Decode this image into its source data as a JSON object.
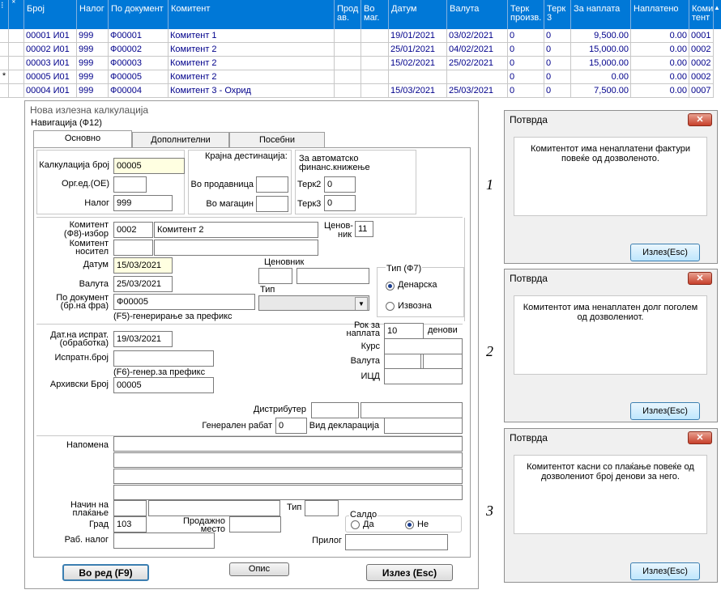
{
  "grid": {
    "headers": [
      "Број",
      "Налог",
      "По документ",
      "Комитент",
      "Прод ав.",
      "Во маг.",
      "Датум",
      "Валута",
      "Терк произв.",
      "Терк 3",
      "За наплата",
      "Наплатено",
      "Коми тент"
    ],
    "rows": [
      {
        "indicator": "",
        "broj": "00001  И01",
        "nalog": "999",
        "dokument": "Ф00001",
        "komitent": "Комитент 1",
        "datum": "19/01/2021",
        "valuta": "03/02/2021",
        "terk1": "0",
        "terk3": "0",
        "za_naplata": "9,500.00",
        "naplateno": "0.00",
        "komitent_kod": "0001"
      },
      {
        "indicator": "",
        "broj": "00002  И01",
        "nalog": "999",
        "dokument": "Ф00002",
        "komitent": "Комитент 2",
        "datum": "25/01/2021",
        "valuta": "04/02/2021",
        "terk1": "0",
        "terk3": "0",
        "za_naplata": "15,000.00",
        "naplateno": "0.00",
        "komitent_kod": "0002"
      },
      {
        "indicator": "",
        "broj": "00003  И01",
        "nalog": "999",
        "dokument": "Ф00003",
        "komitent": "Комитент 2",
        "datum": "15/02/2021",
        "valuta": "25/02/2021",
        "terk1": "0",
        "terk3": "0",
        "za_naplata": "15,000.00",
        "naplateno": "0.00",
        "komitent_kod": "0002"
      },
      {
        "indicator": "*",
        "broj": "00005  И01",
        "nalog": "999",
        "dokument": "Ф00005",
        "komitent": "Комитент 2",
        "datum": "",
        "valuta": "",
        "terk1": "0",
        "terk3": "0",
        "za_naplata": "0.00",
        "naplateno": "0.00",
        "komitent_kod": "0002"
      },
      {
        "indicator": "",
        "broj": "00004  И01",
        "nalog": "999",
        "dokument": "Ф00004",
        "komitent": "Комитент 3 - Охрид",
        "datum": "15/03/2021",
        "valuta": "25/03/2021",
        "terk1": "0",
        "terk3": "0",
        "za_naplata": "7,500.00",
        "naplateno": "0.00",
        "komitent_kod": "0007"
      }
    ]
  },
  "form": {
    "title": "Нова излезна калкулација",
    "nav_label": "Навигација (Ф12)",
    "tabs": [
      "Основно",
      "Дополнителни",
      "Посебни"
    ],
    "kalk_broj_label": "Калкулација број",
    "kalk_broj": "00005",
    "org_ed_label": "Орг.ед.(ОЕ)",
    "nalog_label": "Налог",
    "nalog": "999",
    "krajna_label": "Крајна дестинација:",
    "vo_prodavnica_label": "Во продавница",
    "vo_magacin_label": "Во магацин",
    "avtomatsko_label1": "За автоматско",
    "avtomatsko_label2": "финанс.книжење",
    "terk2_label": "Терк2",
    "terk2": "0",
    "terk3_label": "Терк3",
    "terk3": "0",
    "komitent_label1": "Комитент",
    "komitent_label2": "(Ф8)-избор",
    "komitent_kod": "0002",
    "komitent_ime": "Комитент 2",
    "cenovnik_short1": "Ценов-",
    "cenovnik_short2": "ник",
    "cenovnik_short_val": "11",
    "nositel_label1": "Комитент",
    "nositel_label2": "носител",
    "datum_label": "Датум",
    "datum": "15/03/2021",
    "cenovnik_label": "Ценовник",
    "valuta_label": "Валута",
    "valuta": "25/03/2021",
    "tip_label": "Тип",
    "po_dokument_label1": "По документ",
    "po_dokument_label2": "(бр.на фра)",
    "po_dokument": "Ф00005",
    "generiranje_label": "(F5)-генерирање за префикс",
    "tip_f7_label": "Тип (Ф7)",
    "radio_denarska": "Денарска",
    "radio_izvozna": "Извозна",
    "dat_isprat_label1": "Дат.на испрат.",
    "dat_isprat_label2": "(обработка)",
    "dat_isprat": "19/03/2021",
    "rok_label1": "Рок за",
    "rok_label2": "наплата",
    "rok": "10",
    "denovi_label": "денови",
    "ispratn_label": "Испратн.број",
    "kurs_label": "Курс",
    "generiranje2_label": "(F6)-генер.за префикс",
    "valuta2_label": "Валута",
    "arhivski_label": "Архивски Број",
    "arhivski": "00005",
    "icd_label": "ИЦД",
    "distributer_label": "Дистрибутер",
    "rabat_label": "Генерален рабат",
    "rabat": "0",
    "deklaracija_label": "Вид декларација",
    "napomena_label": "Напомена",
    "nacin_label1": "Начин на",
    "nacin_label2": "плаќање",
    "tip2_label": "Тип",
    "grad_label": "Град",
    "grad": "103",
    "prodazno_label1": "Продажно",
    "prodazno_label2": "место",
    "saldo_label": "Салдо",
    "saldo_da": "Да",
    "saldo_ne": "Не",
    "rab_nalog_label": "Раб. налог",
    "prilog_label": "Прилог",
    "btn_vo_red": "Во ред (F9)",
    "btn_opis": "Опис",
    "btn_izlez": "Излез (Esc)"
  },
  "dialogs": [
    {
      "title": "Потврда",
      "message": "Комитентот има ненаплатени фактури повеќе од дозволеното.",
      "button": "Излез(Esc)",
      "number": "1"
    },
    {
      "title": "Потврда",
      "message": "Комитентот има ненаплатен долг поголем од дозволениот.",
      "button": "Излез(Esc)",
      "number": "2"
    },
    {
      "title": "Потврда",
      "message": "Комитентот касни со плаќање повеќе од дозволениот број денови за него.",
      "button": "Излез(Esc)",
      "number": "3"
    }
  ],
  "colors": {
    "header_bg": "#0078d7",
    "row_text": "#00008b",
    "highlight": "#ffffe1"
  }
}
